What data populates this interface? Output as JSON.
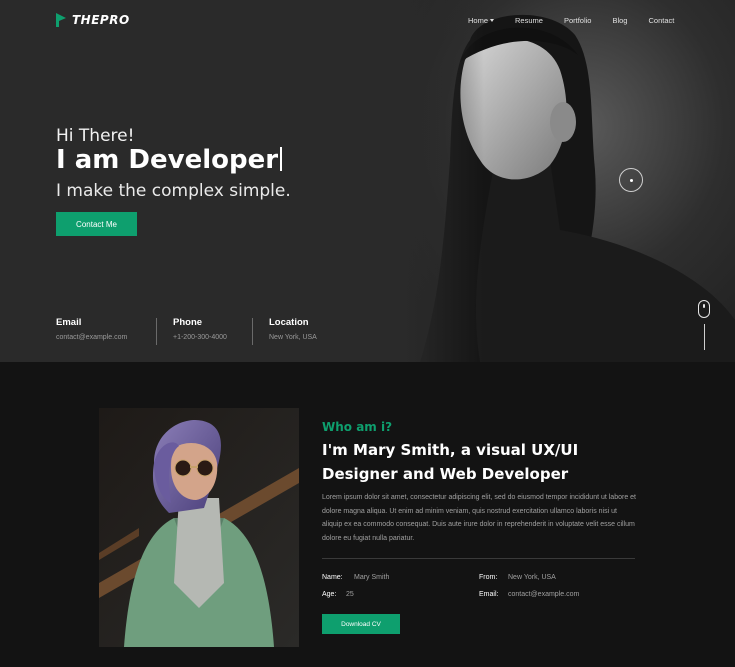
{
  "brand": {
    "name": "THEPRO",
    "accent": "#0e9f6e"
  },
  "nav": {
    "items": [
      {
        "label": "Home",
        "dropdown": true
      },
      {
        "label": "Resume"
      },
      {
        "label": "Portfolio"
      },
      {
        "label": "Blog"
      },
      {
        "label": "Contact"
      }
    ]
  },
  "hero": {
    "greeting": "Hi There!",
    "headline": "I am Developer",
    "tagline": "I make the complex simple.",
    "cta_label": "Contact Me",
    "info": [
      {
        "label": "Email",
        "value": "contact@example.com"
      },
      {
        "label": "Phone",
        "value": "+1-200-300-4000"
      },
      {
        "label": "Location",
        "value": "New York, USA"
      }
    ]
  },
  "about": {
    "kicker": "Who am i?",
    "title": "I'm Mary Smith, a visual UX/UI Designer and Web Developer",
    "description": "Lorem ipsum dolor sit amet, consectetur adipiscing elit, sed do eiusmod tempor incididunt ut labore et dolore magna aliqua. Ut enim ad minim veniam, quis nostrud exercitation ullamco laboris nisi ut aliquip ex ea commodo consequat. Duis aute irure dolor in reprehenderit in voluptate velit esse cillum dolore eu fugiat nulla pariatur.",
    "details": {
      "name_key": "Name:",
      "name_val": "Mary Smith",
      "age_key": "Age:",
      "age_val": "25",
      "from_key": "From:",
      "from_val": "New York, USA",
      "email_key": "Email:",
      "email_val": "contact@example.com"
    },
    "cv_label": "Download CV"
  }
}
